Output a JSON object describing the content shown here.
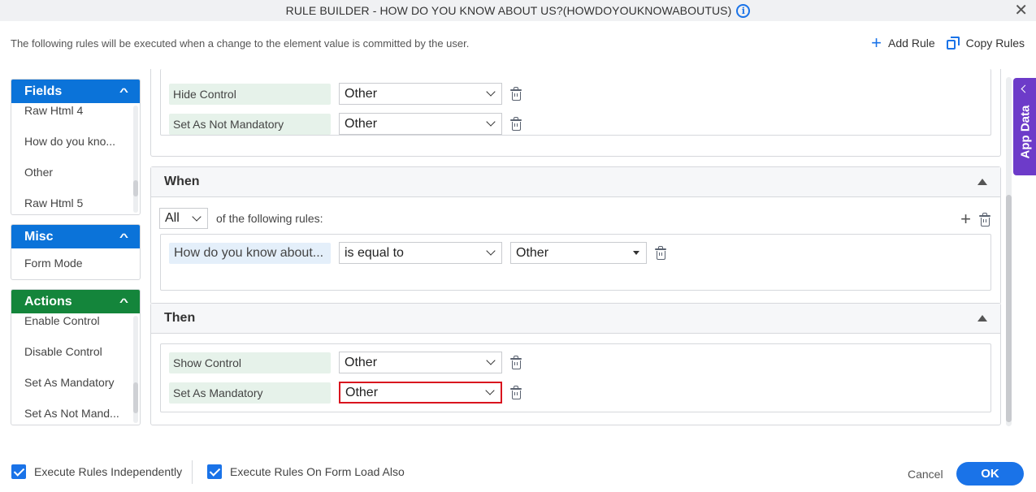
{
  "window": {
    "title": "RULE BUILDER - HOW DO YOU KNOW ABOUT US?(HOWDOYOUKNOWABOUTUS)",
    "info_icon": "info-icon",
    "close_icon": "close-icon"
  },
  "description": "The following rules will be executed when a change to the element value is committed by the user.",
  "toolbar": {
    "add_rule_label": "Add Rule",
    "copy_rules_label": "Copy Rules"
  },
  "sidebar": {
    "fields": {
      "title": "Fields",
      "color": "#0b73d9",
      "items": [
        "Raw Html 4",
        "How do you kno...",
        "Other",
        "Raw Html 5"
      ]
    },
    "misc": {
      "title": "Misc",
      "color": "#0b73d9",
      "items": [
        "Form Mode"
      ]
    },
    "actions": {
      "title": "Actions",
      "color": "#14853b",
      "items": [
        "Enable Control",
        "Disable Control",
        "Set As Mandatory",
        "Set As Not Mand..."
      ]
    }
  },
  "previous_rule": {
    "actions": [
      {
        "action": "Hide Control",
        "value": "Other"
      },
      {
        "action": "Set As Not Mandatory",
        "value": "Other"
      }
    ]
  },
  "when": {
    "title": "When",
    "match_mode": "All",
    "match_suffix": "of the following rules:",
    "conditions": [
      {
        "field": "How do you know about...",
        "operator": "is equal to",
        "value": "Other"
      }
    ]
  },
  "then": {
    "title": "Then",
    "actions": [
      {
        "action": "Show Control",
        "value": "Other"
      },
      {
        "action": "Set As Mandatory",
        "value": "Other",
        "highlighted": true
      }
    ]
  },
  "side_tab": {
    "label": "App Data",
    "color": "#6d3bc9"
  },
  "footer": {
    "execute_independently": {
      "label": "Execute Rules Independently",
      "checked": true
    },
    "execute_on_load": {
      "label": "Execute Rules On Form Load Also",
      "checked": true
    },
    "cancel_label": "Cancel",
    "ok_label": "OK"
  }
}
